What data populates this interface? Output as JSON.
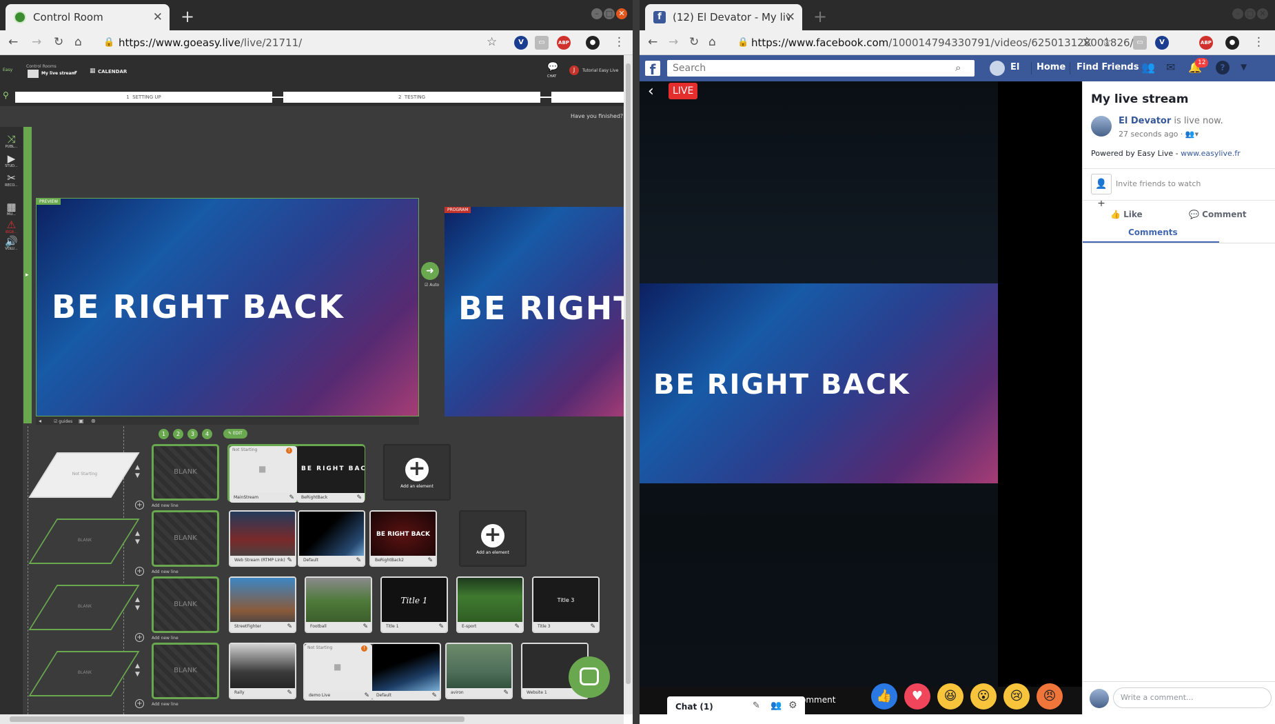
{
  "left_window": {
    "tab_title": "Control Room",
    "url_host": "https://www.goeasy.live",
    "url_path": "/live/21711/",
    "app": {
      "logo_text": "Easy",
      "control_rooms_label": "Control Rooms",
      "stream_name": "My live stream",
      "calendar_label": "CALENDAR",
      "chat_label": "CHAT",
      "user_name": "Tutorial Easy Live",
      "user_initial": "J",
      "steps": [
        {
          "num": "1",
          "label": "SETTING UP"
        },
        {
          "num": "2",
          "label": "TESTING"
        }
      ],
      "finished_prompt": "Have you finished?",
      "sidebar": [
        "PUBL...",
        "STUD...",
        "RECO...",
        "MU...",
        "BIGB...",
        "VOLU..."
      ],
      "preview_label": "PREVIEW",
      "program_label": "PROGRAM",
      "auto_label": "Auto",
      "guides_label": "guides",
      "brb_text": "BE RIGHT BACK",
      "line_numbers": [
        "1",
        "2",
        "3",
        "4"
      ],
      "edit_label": "EDIT",
      "blank_label": "BLANK",
      "add_new_line": "Add new line",
      "add_element": "Add an element",
      "not_starting": "Not Starting",
      "line1": [
        "MainStream",
        "BeRightBack"
      ],
      "line2": [
        "Web Stream (RTMP Link)",
        "Default",
        "BeRightBack2"
      ],
      "line2_brb": "BE RIGHT BACK",
      "line3": [
        "StreetFighter",
        "Football",
        "Title 1",
        "E-sport",
        "Title 3"
      ],
      "line3_title1": "Title 1",
      "line3_title3": "Title 3",
      "line4": [
        "Rally",
        "demo Live",
        "Default",
        "aviron",
        "Website 1"
      ]
    }
  },
  "right_window": {
    "tab_title": "(12) El Devator - My live st",
    "url_host": "https://www.facebook.com",
    "url_path": "/100014794330791/videos/625013128001826/",
    "search_placeholder": "Search",
    "nav": {
      "user": "El",
      "home": "Home",
      "find_friends": "Find Friends",
      "notif_count": "12"
    },
    "live_badge": "LIVE",
    "brb_text": "BE RIGHT BACK",
    "title": "My live stream",
    "author": "El Devator",
    "live_now": " is live now.",
    "time_ago": "27 seconds ago · ",
    "powered_by": "Powered by Easy Live - ",
    "powered_link": "www.easylive.fr",
    "invite": "Invite friends to watch",
    "like": "Like",
    "comment": "Comment",
    "comments_tab": "Comments",
    "chat_label": "Chat (1)",
    "comment_hint": "omment",
    "write_comment": "Write a comment..."
  }
}
